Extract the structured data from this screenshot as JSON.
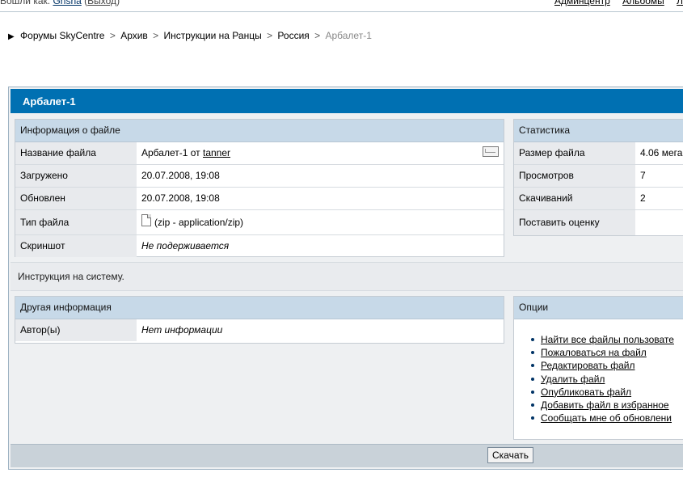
{
  "top": {
    "login_prefix": "Вошли как:",
    "username": "Grisha",
    "logout_open": "(",
    "logout": "Выход",
    "logout_close": ")",
    "admin_link": "Админцентр",
    "albums_link": "Альбомы",
    "extra_link": "Л"
  },
  "breadcrumb": {
    "items": [
      "Форумы SkyCentre",
      "Архив",
      "Инструкции на Ранцы",
      "Россия"
    ],
    "separator": ">",
    "current": "Арбалет-1"
  },
  "page": {
    "title": "Арбалет-1",
    "description": "Инструкция на систему."
  },
  "file_info": {
    "heading": "Информация о файле",
    "rows": [
      {
        "label": "Название файла",
        "value": "Арбалет-1",
        "by": "от",
        "author": "tanner"
      },
      {
        "label": "Загружено",
        "value": "20.07.2008, 19:08"
      },
      {
        "label": "Обновлен",
        "value": "20.07.2008, 19:08"
      },
      {
        "label": "Тип файла",
        "value": "(zip - application/zip)"
      },
      {
        "label": "Скриншот",
        "value": "Не подерживается"
      }
    ]
  },
  "stats": {
    "heading": "Статистика",
    "rows": [
      {
        "label": "Размер файла",
        "value": "4.06 мега"
      },
      {
        "label": "Просмотров",
        "value": "7"
      },
      {
        "label": "Скачиваний",
        "value": "2"
      },
      {
        "label": "Поставить оценку",
        "value": ""
      }
    ]
  },
  "other_info": {
    "heading": "Другая информация",
    "rows": [
      {
        "label": "Автор(ы)",
        "value": "Нет информации"
      }
    ]
  },
  "options": {
    "heading": "Опции",
    "items": [
      "Найти все файлы пользовате",
      "Пожаловаться на файл",
      "Редактировать файл",
      "Удалить файл",
      "Опубликовать файл",
      "Добавить файл в избранное",
      "Сообщать мне об обновлени"
    ]
  },
  "footer": {
    "download_button": "Скачать"
  },
  "icons": {
    "breadcrumb_arrow": "arrow-right-icon",
    "mail": "mail-icon",
    "file_type": "file-icon"
  },
  "colors": {
    "header_blue": "#0070b2",
    "box_header": "#c7d9e8",
    "label_bg": "#e8eaed",
    "footer_bg": "#c9d2d9"
  }
}
